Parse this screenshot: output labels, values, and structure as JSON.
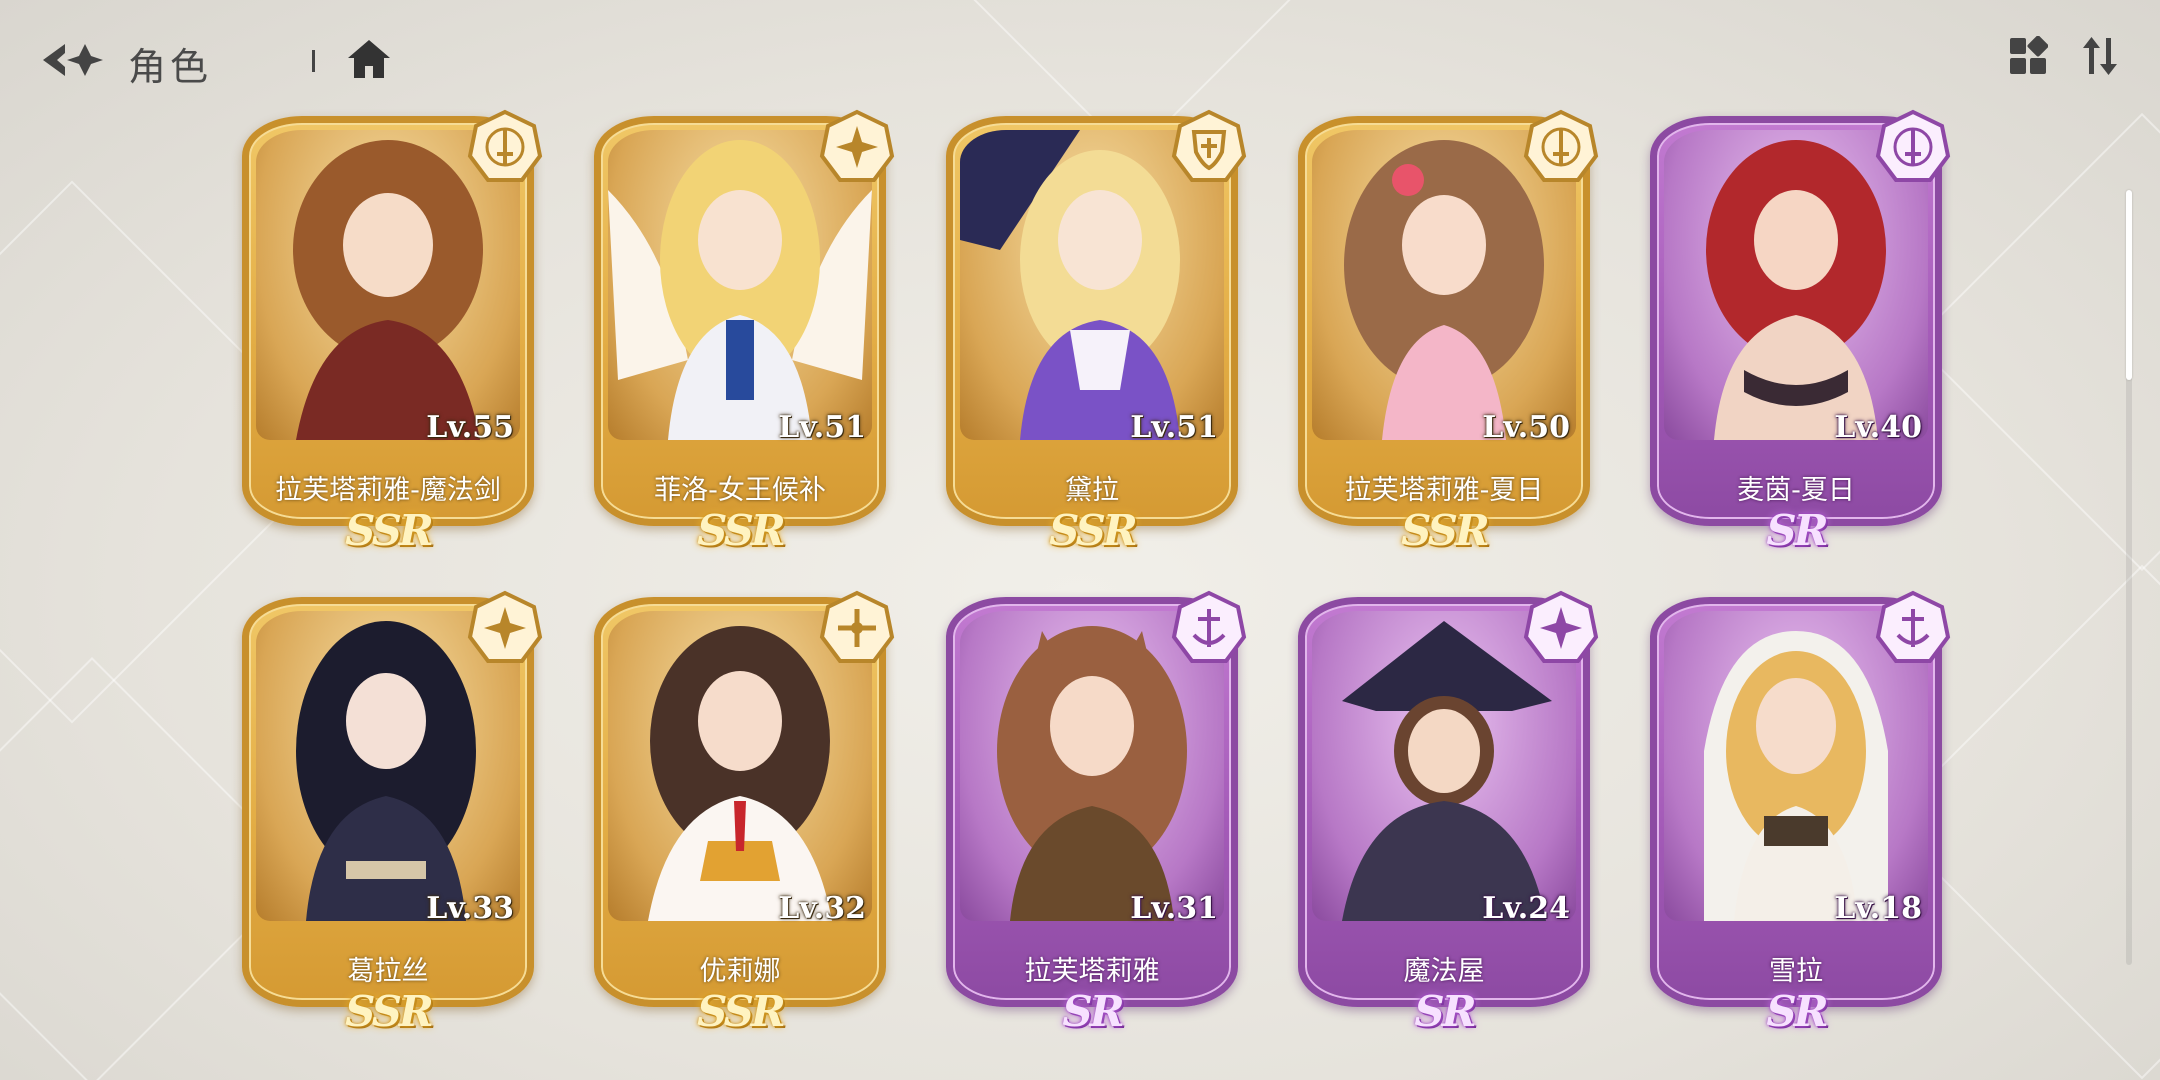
{
  "header": {
    "title": "角色",
    "back_icon": "back-arrow-icon",
    "home_icon": "home-icon",
    "layout_icon": "grid-layout-icon",
    "sort_icon": "sort-icon"
  },
  "colors": {
    "ssr_gold": "#e3ad45",
    "sr_purple": "#a45bb8",
    "background": "#e8e5de"
  },
  "characters": [
    {
      "name": "拉芙塔莉雅-魔法剑",
      "level": "Lv.55",
      "rarity": "SSR",
      "class_icon": "sword-class-icon"
    },
    {
      "name": "菲洛-女王候补",
      "level": "Lv.51",
      "rarity": "SSR",
      "class_icon": "star-class-icon"
    },
    {
      "name": "黛拉",
      "level": "Lv.51",
      "rarity": "SSR",
      "class_icon": "shield-class-icon"
    },
    {
      "name": "拉芙塔莉雅-夏日",
      "level": "Lv.50",
      "rarity": "SSR",
      "class_icon": "sword-class-icon"
    },
    {
      "name": "麦茵-夏日",
      "level": "Lv.40",
      "rarity": "SR",
      "class_icon": "sword-class-icon"
    },
    {
      "name": "葛拉丝",
      "level": "Lv.33",
      "rarity": "SSR",
      "class_icon": "star-class-icon"
    },
    {
      "name": "优莉娜",
      "level": "Lv.32",
      "rarity": "SSR",
      "class_icon": "cross-class-icon"
    },
    {
      "name": "拉芙塔莉雅",
      "level": "Lv.31",
      "rarity": "SR",
      "class_icon": "anchor-class-icon"
    },
    {
      "name": "魔法屋",
      "level": "Lv.24",
      "rarity": "SR",
      "class_icon": "star-class-icon"
    },
    {
      "name": "雪拉",
      "level": "Lv.18",
      "rarity": "SR",
      "class_icon": "anchor-class-icon"
    }
  ]
}
